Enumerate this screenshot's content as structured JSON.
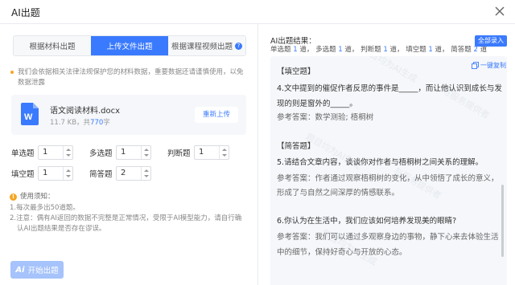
{
  "dialog": {
    "title": "AI出题"
  },
  "tabs": [
    {
      "label": "根据材料出题",
      "active": false
    },
    {
      "label": "上传文件出题",
      "active": true
    },
    {
      "label": "根据课程视频出题",
      "active": false
    }
  ],
  "notice": "我们会依据相关法律法规保护您的材料数据，重要数据还请谨慎使用，以免数据泄露",
  "file": {
    "name": "语文阅读材料.docx",
    "size": "11.7 KB",
    "char_prefix": "，共",
    "char_count": "770",
    "char_suffix": "字",
    "reupload_label": "重新上传"
  },
  "counts": {
    "single_label": "单选题",
    "single_value": "1",
    "multi_label": "多选题",
    "multi_value": "1",
    "judge_label": "判断题",
    "judge_value": "1",
    "fill_label": "填空题",
    "fill_value": "1",
    "short_label": "简答题",
    "short_value": "2"
  },
  "tips": {
    "title": "使用须知：",
    "line1": "1.每次最多出50道题。",
    "line2a": "2.注意：偶有AI返回的数据不完整是正常情况，受限于AI模型能力，请自行确",
    "line2b": "认AI出题结果是否存在谬误。"
  },
  "start_button": {
    "icon": "Ai",
    "label": "开始出题"
  },
  "result": {
    "title": "AI出题结果：",
    "stats": [
      {
        "name": "单选题",
        "n": "1",
        "unit": "道，"
      },
      {
        "name": "多选题",
        "n": "1",
        "unit": "道，"
      },
      {
        "name": "判断题",
        "n": "1",
        "unit": "道，"
      },
      {
        "name": "填空题",
        "n": "1",
        "unit": "道，"
      },
      {
        "name": "简答题",
        "n": "2",
        "unit": "道"
      }
    ],
    "import_all_label": "全部录入",
    "copy_label": "一键复制",
    "lines": [
      "【填空题】",
      "4.文中提到的催促作者反思的事件是_____，而让他认识到成长与发",
      "现的则是窗外的_____。",
      "参考答案：数学测验; 梧桐树",
      "",
      "【简答题】",
      "5.请结合文章内容，谈谈你对作者与梧桐树之间关系的理解。",
      "参考答案：作者通过观察梧桐树的变化，从中领悟了成长的意义，",
      "形成了与自然之间深厚的情感联系。",
      "",
      "6.你认为在生活中，我们应该如何培养发现美的眼睛?",
      "参考答案：我们可以通过多观察身边的事物，静下心来去体验生活",
      "中的细节，保持好奇心与开放的心态。"
    ],
    "watermarks": [
      "题目均为AI生成",
      "与服务提供者"
    ]
  },
  "colors": {
    "accent": "#3a7afe",
    "disabled_accent": "#a6c3fb",
    "warn": "#f5a623"
  }
}
